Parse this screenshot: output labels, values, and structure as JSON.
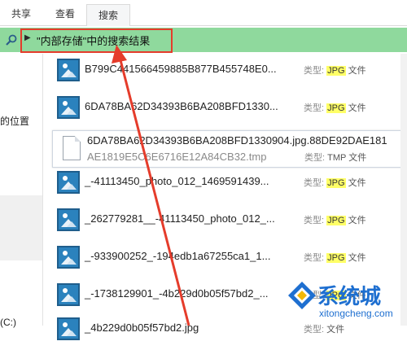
{
  "ribbon": {
    "tabs": [
      {
        "label": "共享",
        "active": false
      },
      {
        "label": "查看",
        "active": false
      },
      {
        "label": "搜索",
        "active": true
      }
    ]
  },
  "address_bar": {
    "text": "\"内部存储\"中的搜索结果",
    "icon": "search-icon",
    "bg_color": "#8fd99d"
  },
  "nav_pane": {
    "items": [
      {
        "label": "的位置"
      },
      {
        "label": "(C:)"
      }
    ]
  },
  "files": [
    {
      "name": "B799C441566459885B877B455748E0...",
      "type_prefix": "类型:",
      "type_ext": "JPG",
      "type_suffix": "文件",
      "icon": "image-file-icon"
    },
    {
      "name": "6DA78BA62D34393B6BA208BFD1330...",
      "type_prefix": "类型:",
      "type_ext": "JPG",
      "type_suffix": "文件",
      "icon": "image-file-icon"
    },
    {
      "name": "6DA78BA62D34393B6BA208BFD1330904.jpg.88DE92DAE181",
      "name_line2": "AE1819E5C6E6716E12A84CB32.tmp",
      "type_prefix": "类型:",
      "type_ext": "TMP",
      "type_suffix": "文件",
      "icon": "document-file-icon"
    },
    {
      "name": "_-41113450_photo_012_1469591439...",
      "type_prefix": "类型:",
      "type_ext": "JPG",
      "type_suffix": "文件",
      "icon": "image-file-icon"
    },
    {
      "name": "_262779281__-41113450_photo_012_...",
      "type_prefix": "类型:",
      "type_ext": "JPG",
      "type_suffix": "文件",
      "icon": "image-file-icon"
    },
    {
      "name": "_-933900252_-194edb1a67255ca1_1...",
      "type_prefix": "类型:",
      "type_ext": "JPG",
      "type_suffix": "文件",
      "icon": "image-file-icon"
    },
    {
      "name": "_-1738129901_-4b229d0b05f57bd2_...",
      "type_prefix": "类型:",
      "type_ext": "JPG",
      "type_suffix": "文件",
      "icon": "image-file-icon"
    },
    {
      "name": "_4b229d0b05f57bd2.jpg",
      "type_prefix": "类型:",
      "type_ext": "",
      "type_suffix": "文件",
      "icon": "image-file-icon"
    }
  ],
  "watermark": {
    "text": "系统城",
    "url": "xitongcheng.com"
  },
  "colors": {
    "highlight_box": "#e53c2b",
    "arrow": "#e53c2b",
    "thumbnail": "#2b82bd"
  }
}
